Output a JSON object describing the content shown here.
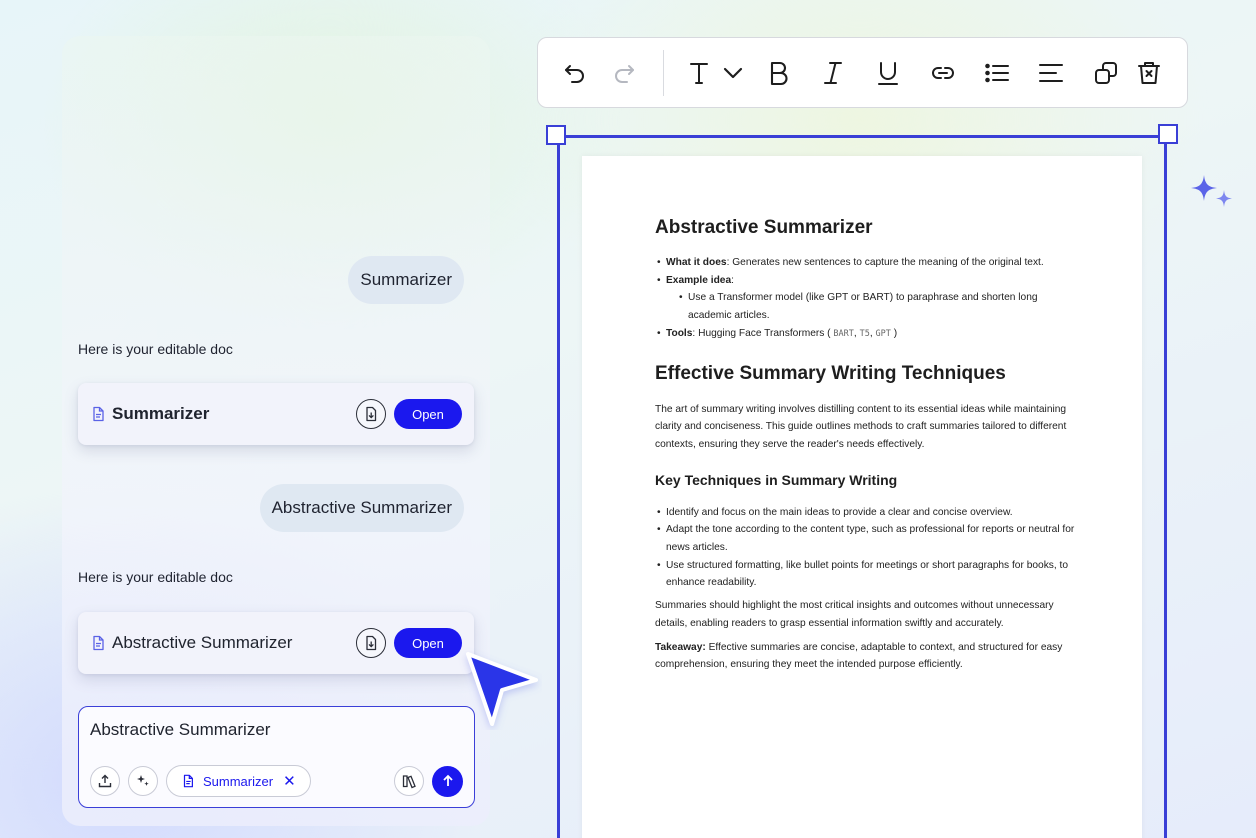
{
  "chat": {
    "messages": {
      "user_1": "Summarizer",
      "assistant_1": "Here is your editable doc",
      "user_2": "Abstractive Summarizer",
      "assistant_2": "Here is your editable doc"
    },
    "cards": {
      "card_1": {
        "title": "Summarizer",
        "open_label": "Open"
      },
      "card_2": {
        "title": "Abstractive Summarizer",
        "open_label": "Open"
      }
    },
    "composer": {
      "text": "Abstractive Summarizer",
      "chip_label": "Summarizer",
      "chip_remove": "✕"
    }
  },
  "toolbar": {
    "icons": [
      "undo-icon",
      "redo-icon",
      "text-style-icon",
      "chevron-down-icon",
      "bold-icon",
      "italic-icon",
      "underline-icon",
      "link-icon",
      "bulleted-list-icon",
      "align-left-icon",
      "duplicate-icon",
      "delete-icon"
    ]
  },
  "doc": {
    "title": "Abstractive Summarizer",
    "what_label": "What it does",
    "what_text": ": Generates new sentences to capture the meaning of the original text.",
    "example_label": "Example idea",
    "example_colon": ":",
    "example_sub": "Use a Transformer model (like GPT or BART) to paraphrase and shorten long academic articles.",
    "tools_label": "Tools",
    "tools_text": ": Hugging Face Transformers (",
    "tools_code_1": "BART",
    "tools_code_2": "T5",
    "tools_code_3": "GPT",
    "tools_sep": ", ",
    "tools_end": ")",
    "h2": "Effective Summary Writing Techniques",
    "intro": "The art of summary writing involves distilling content to its essential ideas while maintaining clarity and conciseness. This guide outlines methods to craft summaries tailored to different contexts, ensuring they serve the reader's needs effectively.",
    "h3": "Key Techniques in Summary Writing",
    "bullets": [
      "Identify and focus on the main ideas to provide a clear and concise overview.",
      "Adapt the tone according to the content type, such as professional for reports or neutral for news articles.",
      "Use structured formatting, like bullet points for meetings or short paragraphs for books, to enhance readability."
    ],
    "para": "Summaries should highlight the most critical insights and outcomes without unnecessary details, enabling readers to grasp essential information swiftly and accurately.",
    "takeaway_label": "Takeaway:",
    "takeaway_text": " Effective summaries are concise, adaptable to context, and structured for easy comprehension, ensuring they meet the intended purpose efficiently."
  },
  "colors": {
    "accent": "#1b18ee",
    "selection": "#3a3fd6",
    "sparkle": "#5b64e8"
  }
}
